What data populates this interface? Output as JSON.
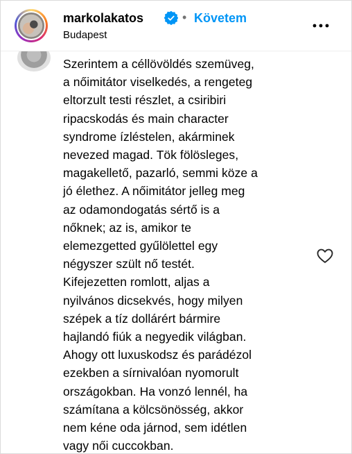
{
  "header": {
    "username": "markolakatos",
    "follow_label": "Követem",
    "separator": "•",
    "location": "Budapest",
    "verified_color": "#0095f6",
    "follow_color": "#0095f6"
  },
  "icons": {
    "verified": "verified-badge-icon",
    "more": "more-options-icon",
    "like": "heart-icon"
  },
  "comment": {
    "lines": [
      "Szerintem a céllövöldés szemüveg,",
      "a nőimitátor viselkedés, a rengeteg",
      "eltorzult testi részlet, a csiribiri",
      "ripacskodás és main character",
      "syndrome ízléstelen, akárminek",
      "nevezed magad. Tök fölösleges,",
      "magakellető, pazarló, semmi köze a",
      "jó élethez. A nőimitátor jelleg meg",
      "az odamondogatás sértő is a",
      "nőknek; az is, amikor te",
      "elemezgetted gyűlölettel egy",
      "négyszer szült nő testét.",
      "Kifejezetten romlott, aljas a",
      "nyilvános dicsekvés, hogy milyen",
      "szépek a tíz dollárért bármire",
      "hajlandó fiúk a negyedik világban.",
      "Ahogy ott luxuskodsz és parádézol",
      "ezekben a sírnivalóan nyomorult",
      "országokban. Ha vonzó lennél, ha",
      "számítana a kölcsönösség, akkor",
      "nem kéne oda járnod, sem idétlen",
      "vagy női cuccokban."
    ]
  }
}
